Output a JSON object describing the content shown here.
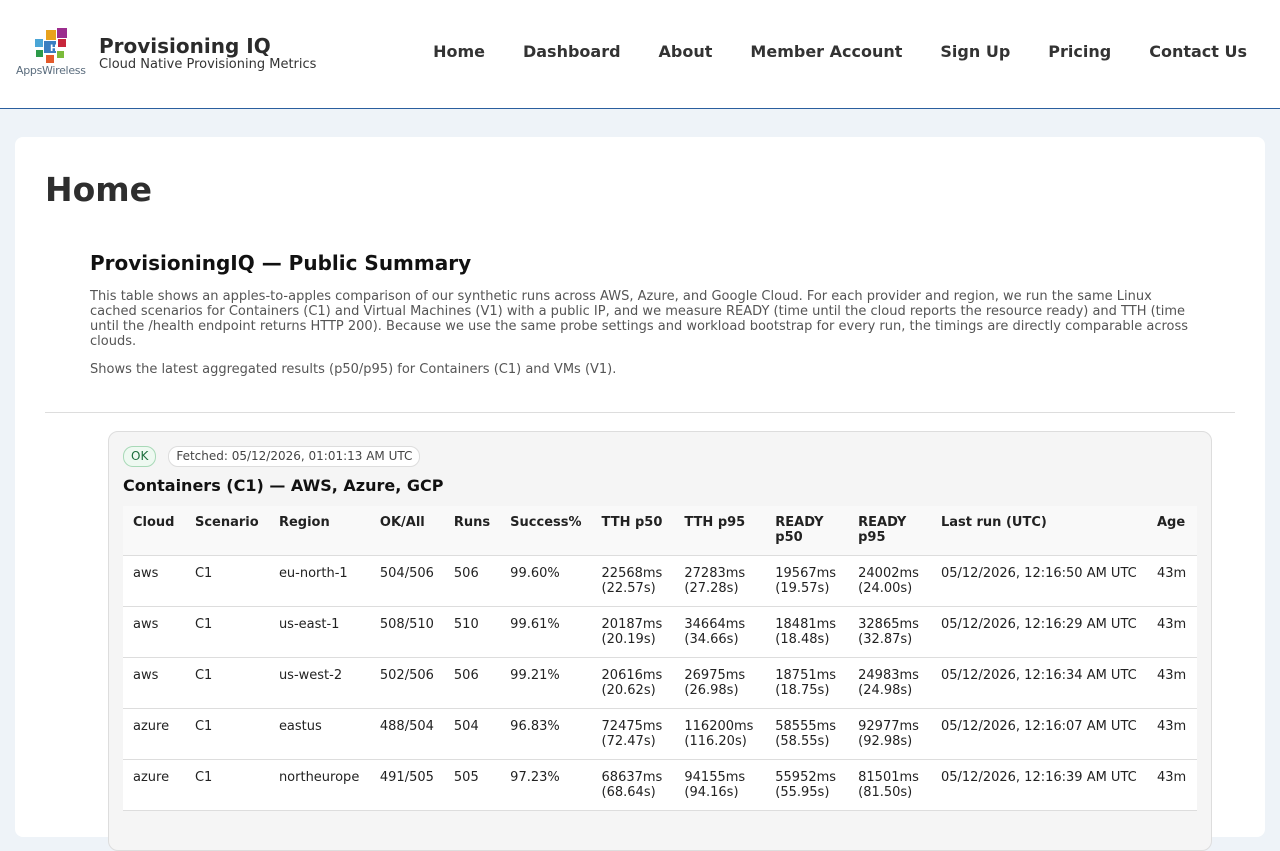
{
  "brand": {
    "logo_text": "AppsWireless",
    "title": "Provisioning IQ",
    "subtitle": "Cloud Native Provisioning Metrics"
  },
  "nav": [
    "Home",
    "Dashboard",
    "About",
    "Member Account",
    "Sign Up",
    "Pricing",
    "Contact Us"
  ],
  "page": {
    "title": "Home"
  },
  "summary": {
    "heading": "ProvisioningIQ — Public Summary",
    "paragraph1": "This table shows an apples-to-apples comparison of our synthetic runs across AWS, Azure, and Google Cloud. For each provider and region, we run the same Linux cached scenarios for Containers (C1) and Virtual Machines (V1) with a public IP, and we measure READY (time until the cloud reports the resource ready) and TTH (time until the /health endpoint returns HTTP 200). Because we use the same probe settings and workload bootstrap for every run, the timings are directly comparable across clouds.",
    "paragraph2": "Shows the latest aggregated results (p50/p95) for Containers (C1) and VMs (V1)."
  },
  "panel": {
    "status": "OK",
    "fetched": "Fetched: 05/12/2026, 01:01:13 AM UTC",
    "heading": "Containers (C1) — AWS, Azure, GCP"
  },
  "table": {
    "headers": [
      "Cloud",
      "Scenario",
      "Region",
      "OK/All",
      "Runs",
      "Success%",
      "TTH p50",
      "TTH p95",
      "READY p50",
      "READY p95",
      "Last run (UTC)",
      "Age"
    ],
    "rows": [
      {
        "cloud": "aws",
        "scenario": "C1",
        "region": "eu-north-1",
        "ok_all": "504/506",
        "runs": "506",
        "success": "99.60%",
        "tth_p50": "22568ms",
        "tth_p50_s": "(22.57s)",
        "tth_p95": "27283ms",
        "tth_p95_s": "(27.28s)",
        "ready_p50": "19567ms",
        "ready_p50_s": "(19.57s)",
        "ready_p95": "24002ms",
        "ready_p95_s": "(24.00s)",
        "last_run": "05/12/2026, 12:16:50 AM UTC",
        "age": "43m"
      },
      {
        "cloud": "aws",
        "scenario": "C1",
        "region": "us-east-1",
        "ok_all": "508/510",
        "runs": "510",
        "success": "99.61%",
        "tth_p50": "20187ms",
        "tth_p50_s": "(20.19s)",
        "tth_p95": "34664ms",
        "tth_p95_s": "(34.66s)",
        "ready_p50": "18481ms",
        "ready_p50_s": "(18.48s)",
        "ready_p95": "32865ms",
        "ready_p95_s": "(32.87s)",
        "last_run": "05/12/2026, 12:16:29 AM UTC",
        "age": "43m"
      },
      {
        "cloud": "aws",
        "scenario": "C1",
        "region": "us-west-2",
        "ok_all": "502/506",
        "runs": "506",
        "success": "99.21%",
        "tth_p50": "20616ms",
        "tth_p50_s": "(20.62s)",
        "tth_p95": "26975ms",
        "tth_p95_s": "(26.98s)",
        "ready_p50": "18751ms",
        "ready_p50_s": "(18.75s)",
        "ready_p95": "24983ms",
        "ready_p95_s": "(24.98s)",
        "last_run": "05/12/2026, 12:16:34 AM UTC",
        "age": "43m"
      },
      {
        "cloud": "azure",
        "scenario": "C1",
        "region": "eastus",
        "ok_all": "488/504",
        "runs": "504",
        "success": "96.83%",
        "tth_p50": "72475ms",
        "tth_p50_s": "(72.47s)",
        "tth_p95": "116200ms",
        "tth_p95_s": "(116.20s)",
        "ready_p50": "58555ms",
        "ready_p50_s": "(58.55s)",
        "ready_p95": "92977ms",
        "ready_p95_s": "(92.98s)",
        "last_run": "05/12/2026, 12:16:07 AM UTC",
        "age": "43m"
      },
      {
        "cloud": "azure",
        "scenario": "C1",
        "region": "northeurope",
        "ok_all": "491/505",
        "runs": "505",
        "success": "97.23%",
        "tth_p50": "68637ms",
        "tth_p50_s": "(68.64s)",
        "tth_p95": "94155ms",
        "tth_p95_s": "(94.16s)",
        "ready_p50": "55952ms",
        "ready_p50_s": "(55.95s)",
        "ready_p95": "81501ms",
        "ready_p95_s": "(81.50s)",
        "last_run": "05/12/2026, 12:16:39 AM UTC",
        "age": "43m"
      }
    ]
  }
}
